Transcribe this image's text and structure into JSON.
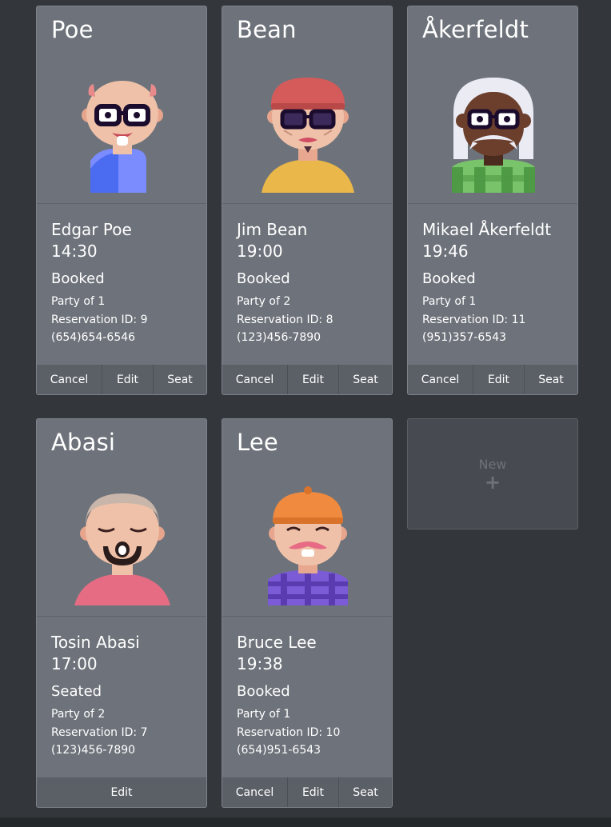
{
  "cards": [
    {
      "surname": "Poe",
      "full_name": "Edgar Poe",
      "time": "14:30",
      "status": "Booked",
      "party": "Party of 1",
      "reservation": "Reservation ID: 9",
      "phone": "(654)654-6546",
      "actions": {
        "cancel": "Cancel",
        "edit": "Edit",
        "seat": "Seat"
      }
    },
    {
      "surname": "Bean",
      "full_name": "Jim Bean",
      "time": "19:00",
      "status": "Booked",
      "party": "Party of 2",
      "reservation": "Reservation ID: 8",
      "phone": "(123)456-7890",
      "actions": {
        "cancel": "Cancel",
        "edit": "Edit",
        "seat": "Seat"
      }
    },
    {
      "surname": "Åkerfeldt",
      "full_name": "Mikael Åkerfeldt",
      "time": "19:46",
      "status": "Booked",
      "party": "Party of 1",
      "reservation": "Reservation ID: 11",
      "phone": "(951)357-6543",
      "actions": {
        "cancel": "Cancel",
        "edit": "Edit",
        "seat": "Seat"
      }
    },
    {
      "surname": "Abasi",
      "full_name": "Tosin Abasi",
      "time": "17:00",
      "status": "Seated",
      "party": "Party of 2",
      "reservation": "Reservation ID: 7",
      "phone": "(123)456-7890",
      "actions": {
        "edit": "Edit"
      }
    },
    {
      "surname": "Lee",
      "full_name": "Bruce Lee",
      "time": "19:38",
      "status": "Booked",
      "party": "Party of 1",
      "reservation": "Reservation ID: 10",
      "phone": "(654)951-6543",
      "actions": {
        "cancel": "Cancel",
        "edit": "Edit",
        "seat": "Seat"
      }
    }
  ],
  "new_card": {
    "label": "New",
    "icon": "plus-icon"
  },
  "avatars": [
    "bald-man-glasses-avatar",
    "red-cap-man-glasses-avatar",
    "white-hair-man-glasses-avatar",
    "bearded-man-eyes-closed-avatar",
    "orange-cap-man-mustache-avatar"
  ],
  "colors": {
    "background": "#33373b",
    "card": "#6e737b",
    "action_bar": "#5b6067",
    "new_card": "#474b51"
  }
}
